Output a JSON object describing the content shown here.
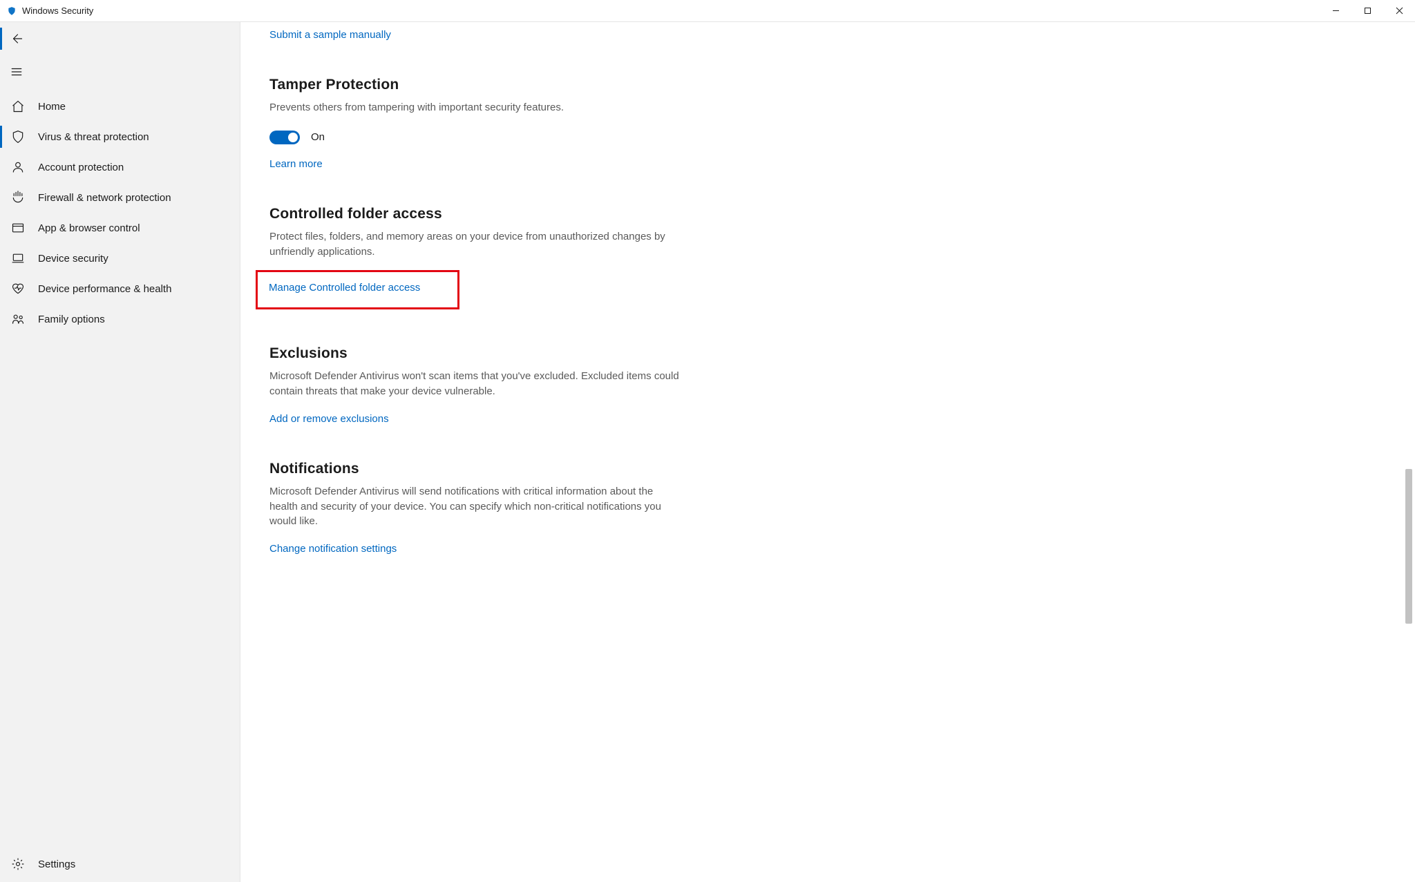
{
  "window": {
    "title": "Windows Security"
  },
  "sidebar": {
    "items": [
      {
        "id": "home",
        "label": "Home",
        "icon": "home-icon",
        "active": false
      },
      {
        "id": "virus",
        "label": "Virus & threat protection",
        "icon": "shield-icon",
        "active": true
      },
      {
        "id": "account",
        "label": "Account protection",
        "icon": "person-icon",
        "active": false
      },
      {
        "id": "firewall",
        "label": "Firewall & network protection",
        "icon": "wifi-icon",
        "active": false
      },
      {
        "id": "app",
        "label": "App & browser control",
        "icon": "window-icon",
        "active": false
      },
      {
        "id": "device",
        "label": "Device security",
        "icon": "laptop-icon",
        "active": false
      },
      {
        "id": "health",
        "label": "Device performance & health",
        "icon": "heart-icon",
        "active": false
      },
      {
        "id": "family",
        "label": "Family options",
        "icon": "family-icon",
        "active": false
      }
    ],
    "settings_label": "Settings"
  },
  "main": {
    "top_link": "Submit a sample manually",
    "sections": {
      "tamper": {
        "title": "Tamper Protection",
        "desc": "Prevents others from tampering with important security features.",
        "toggle_state": "On",
        "learn_link": "Learn more"
      },
      "cfa": {
        "title": "Controlled folder access",
        "desc": "Protect files, folders, and memory areas on your device from unauthorized changes by unfriendly applications.",
        "link": "Manage Controlled folder access"
      },
      "exclusions": {
        "title": "Exclusions",
        "desc": "Microsoft Defender Antivirus won't scan items that you've excluded. Excluded items could contain threats that make your device vulnerable.",
        "link": "Add or remove exclusions"
      },
      "notifications": {
        "title": "Notifications",
        "desc": "Microsoft Defender Antivirus will send notifications with critical information about the health and security of your device. You can specify which non-critical notifications you would like.",
        "link": "Change notification settings"
      }
    }
  }
}
